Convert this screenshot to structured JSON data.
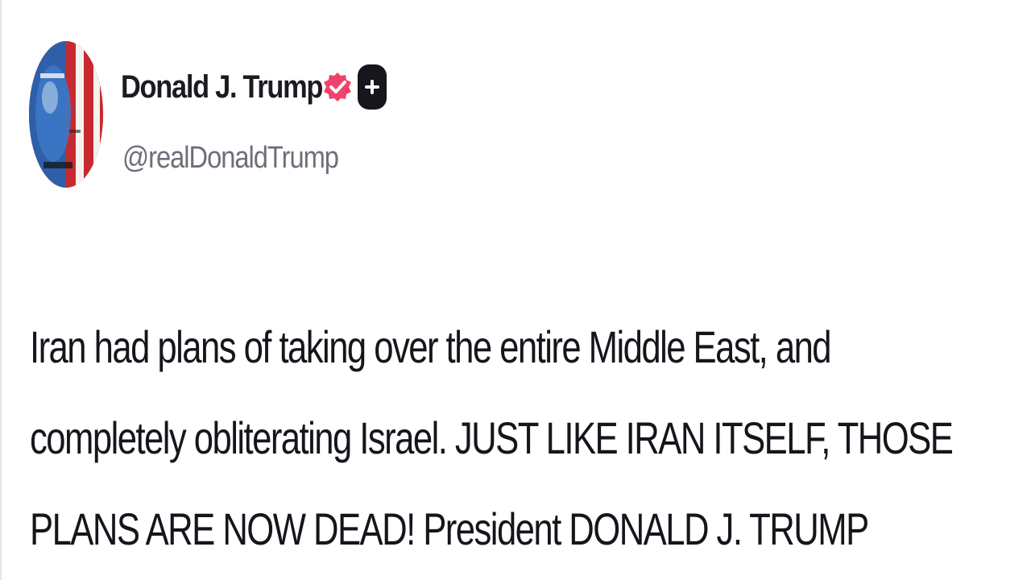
{
  "post": {
    "author": {
      "display_name": "Donald J. Trump",
      "handle": "@realDonaldTrump",
      "verified_icon": "verified-check-icon",
      "plus_icon": "plus-icon",
      "avatar_icon": "avatar-portrait-flag"
    },
    "body_lines": [
      "Iran had plans of taking over the entire Middle East, and",
      "completely obliterating Israel. JUST LIKE IRAN ITSELF, THOSE",
      "PLANS ARE NOW DEAD! President DONALD J. TRUMP"
    ]
  },
  "colors": {
    "verified_badge": "#f0436b",
    "plus_badge": "#16161d",
    "handle": "#6f6f7a",
    "text": "#16151c"
  }
}
